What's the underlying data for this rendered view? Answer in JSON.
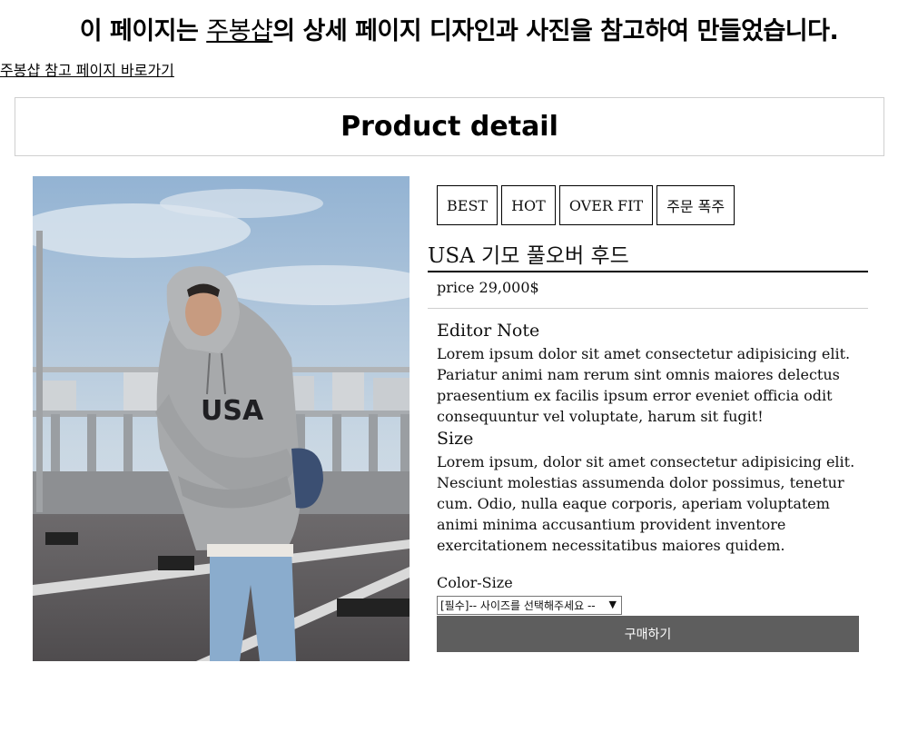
{
  "banner": {
    "prefix": "이 페이지는 ",
    "highlight": "주봉샵",
    "suffix": "의 상세 페이지 디자인과 사진을 참고하여 만들었습니다."
  },
  "reference_link": "주봉샵 참고 페이지 바로가기",
  "section_header": "Product detail",
  "tags": [
    "BEST",
    "HOT",
    "OVER FIT",
    "주문 폭주"
  ],
  "product": {
    "name": "USA 기모 풀오버 후드",
    "price": "price 29,000$",
    "photo_text": "USA"
  },
  "editor_note": {
    "title": "Editor Note",
    "text": "Lorem ipsum dolor sit amet consectetur adipisicing elit. Pariatur animi nam rerum sint omnis maiores delectus praesentium ex facilis ipsum error eveniet officia odit consequuntur vel voluptate, harum sit fugit!"
  },
  "size": {
    "title": "Size",
    "text": "Lorem ipsum, dolor sit amet consectetur adipisicing elit. Nesciunt molestias assumenda dolor possimus, tenetur cum. Odio, nulla eaque corporis, aperiam voluptatem animi minima accusantium provident inventore exercitationem necessitatibus maiores quidem."
  },
  "options": {
    "label": "Color-Size",
    "selected": "[필수]-- 사이즈를 선택해주세요 --"
  },
  "buy_label": "구매하기",
  "colors": {
    "buy_button": "#5e5e5e",
    "header_border": "#cfcfcf"
  }
}
